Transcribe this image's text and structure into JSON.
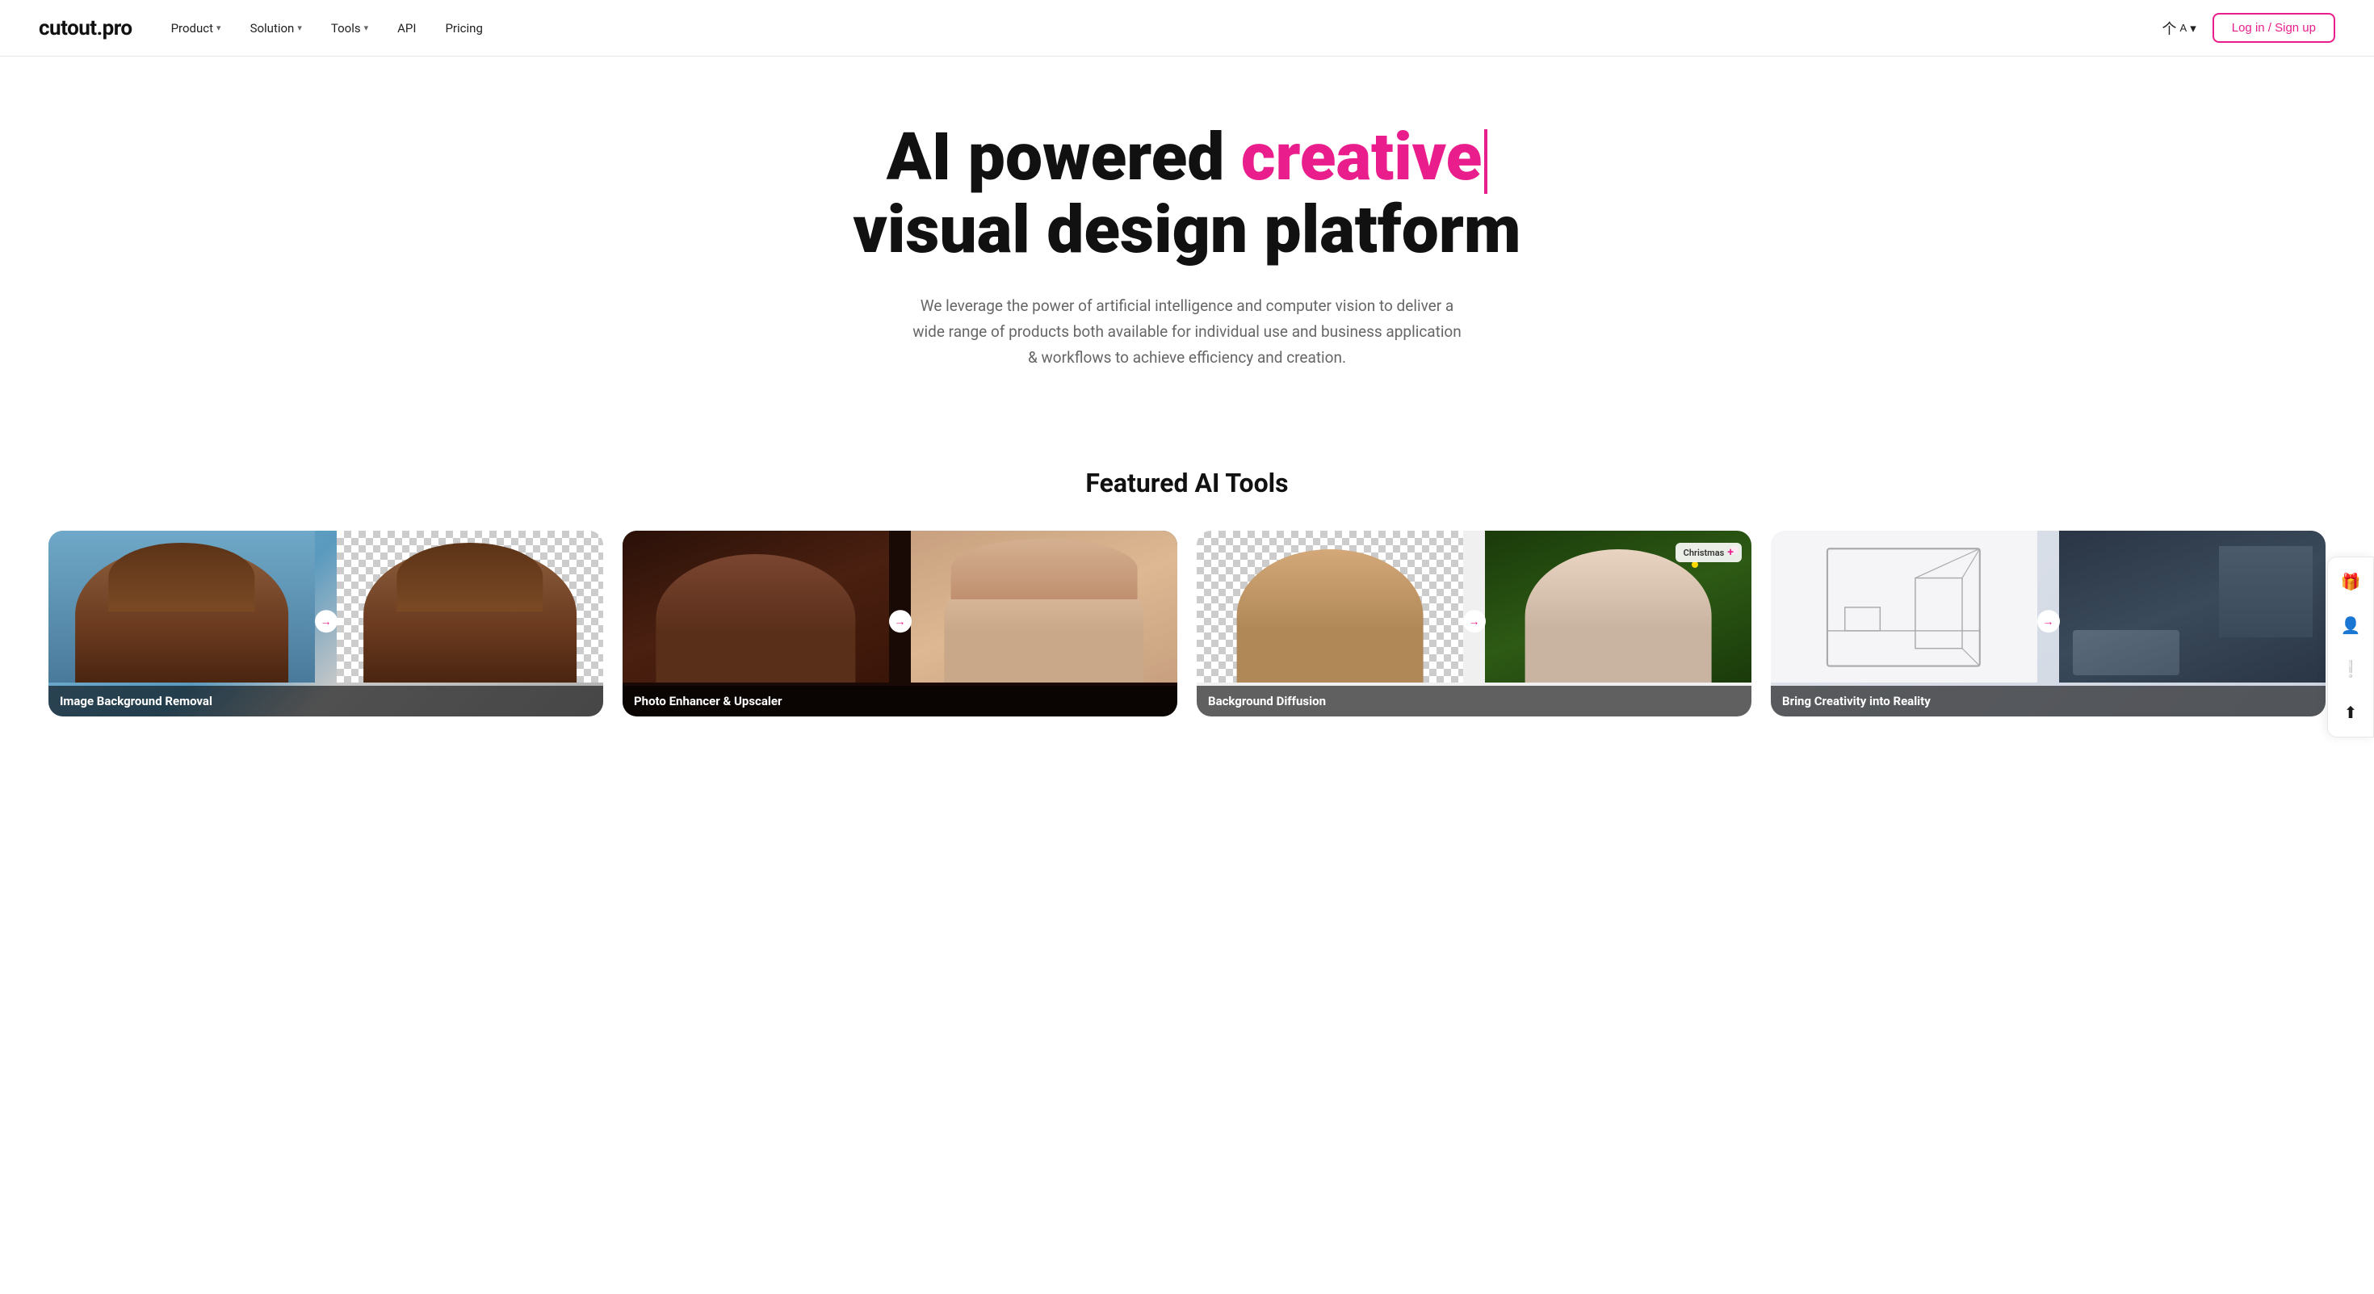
{
  "brand": {
    "logo": "cutout.pro"
  },
  "nav": {
    "links": [
      {
        "id": "product",
        "label": "Product",
        "hasDropdown": true
      },
      {
        "id": "solution",
        "label": "Solution",
        "hasDropdown": true
      },
      {
        "id": "tools",
        "label": "Tools",
        "hasDropdown": true
      },
      {
        "id": "api",
        "label": "API",
        "hasDropdown": false
      },
      {
        "id": "pricing",
        "label": "Pricing",
        "hasDropdown": false
      }
    ],
    "lang_label": "A",
    "login_label": "Log in / Sign up"
  },
  "hero": {
    "title_part1": "AI powered ",
    "title_accent": "creative",
    "title_part2": "visual design platform",
    "subtitle": "We leverage the power of artificial intelligence and computer vision to deliver a wide range of products both available for individual use and business application & workflows to achieve efficiency and creation."
  },
  "featured": {
    "section_title": "Featured AI Tools",
    "tools": [
      {
        "id": "bg-removal",
        "label": "Image Background Removal"
      },
      {
        "id": "photo-enhancer",
        "label": "Photo Enhancer & Upscaler"
      },
      {
        "id": "bg-diffusion",
        "label": "Background Diffusion",
        "badge": "Christmas"
      },
      {
        "id": "creativity",
        "label": "Bring Creativity into Reality"
      }
    ]
  },
  "sidebar": {
    "icons": [
      {
        "id": "gift",
        "symbol": "🎁"
      },
      {
        "id": "avatar",
        "symbol": "👤"
      },
      {
        "id": "alert",
        "symbol": "❗"
      },
      {
        "id": "upload",
        "symbol": "⬆"
      }
    ]
  },
  "colors": {
    "accent": "#e91e8c",
    "text_dark": "#111111",
    "text_muted": "#666666",
    "border": "#e8e8e8"
  }
}
